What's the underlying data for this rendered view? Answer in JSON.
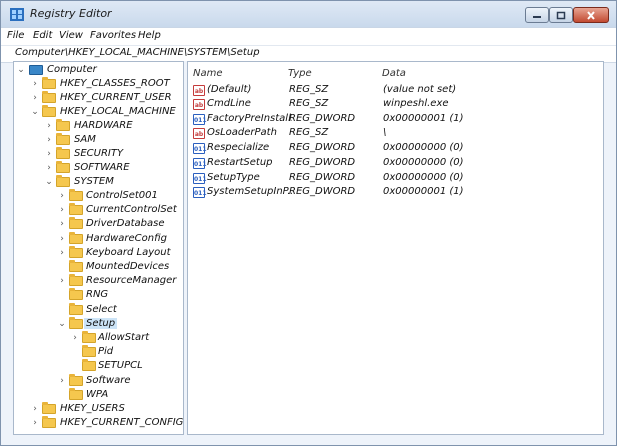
{
  "window": {
    "title": "Registry Editor",
    "accent": "#cce4f7"
  },
  "menu": {
    "file": "File",
    "edit": "Edit",
    "view": "View",
    "favorites": "Favorites",
    "help": "Help"
  },
  "address": "Computer\\HKEY_LOCAL_MACHINE\\SYSTEM\\Setup",
  "tree": [
    {
      "label": "Computer",
      "icon": "computer-icon",
      "expanded": true
    },
    {
      "label": "HKEY_CLASSES_ROOT",
      "icon": "folder-icon",
      "expanded": false
    },
    {
      "label": "HKEY_CURRENT_USER",
      "icon": "folder-icon",
      "expanded": false
    },
    {
      "label": "HKEY_LOCAL_MACHINE",
      "icon": "folder-icon",
      "expanded": true
    },
    {
      "label": "HARDWARE",
      "icon": "folder-icon",
      "expanded": false
    },
    {
      "label": "SAM",
      "icon": "folder-icon",
      "expanded": false
    },
    {
      "label": "SECURITY",
      "icon": "folder-icon",
      "expanded": false
    },
    {
      "label": "SOFTWARE",
      "icon": "folder-icon",
      "expanded": false
    },
    {
      "label": "SYSTEM",
      "icon": "folder-icon",
      "expanded": true
    },
    {
      "label": "ControlSet001",
      "icon": "folder-icon",
      "expanded": false
    },
    {
      "label": "CurrentControlSet",
      "icon": "folder-icon",
      "expanded": false
    },
    {
      "label": "DriverDatabase",
      "icon": "folder-icon",
      "expanded": false
    },
    {
      "label": "HardwareConfig",
      "icon": "folder-icon",
      "expanded": false
    },
    {
      "label": "Keyboard Layout",
      "icon": "folder-icon",
      "expanded": false
    },
    {
      "label": "MountedDevices",
      "icon": "folder-icon",
      "expanded": false
    },
    {
      "label": "ResourceManager",
      "icon": "folder-icon",
      "expanded": false
    },
    {
      "label": "RNG",
      "icon": "folder-icon",
      "expanded": false
    },
    {
      "label": "Select",
      "icon": "folder-icon",
      "expanded": false
    },
    {
      "label": "Setup",
      "icon": "folder-icon",
      "expanded": true,
      "selected": true
    },
    {
      "label": "AllowStart",
      "icon": "folder-icon",
      "expanded": false
    },
    {
      "label": "Pid",
      "icon": "folder-icon",
      "expanded": false
    },
    {
      "label": "SETUPCL",
      "icon": "folder-icon",
      "expanded": false
    },
    {
      "label": "Software",
      "icon": "folder-icon",
      "expanded": false
    },
    {
      "label": "WPA",
      "icon": "folder-icon",
      "expanded": false
    },
    {
      "label": "HKEY_USERS",
      "icon": "folder-icon",
      "expanded": false
    },
    {
      "label": "HKEY_CURRENT_CONFIG",
      "icon": "folder-icon",
      "expanded": false
    }
  ],
  "columns": {
    "name": "Name",
    "type": "Type",
    "data": "Data"
  },
  "values": [
    {
      "name": "(Default)",
      "type": "REG_SZ",
      "data": "(value not set)",
      "icon": "string-value-icon",
      "icon_text": "ab"
    },
    {
      "name": "CmdLine",
      "type": "REG_SZ",
      "data": "winpeshl.exe",
      "icon": "string-value-icon",
      "icon_text": "ab"
    },
    {
      "name": "FactoryPreInstall...",
      "type": "REG_DWORD",
      "data": "0x00000001 (1)",
      "icon": "dword-value-icon",
      "icon_text": "011"
    },
    {
      "name": "OsLoaderPath",
      "type": "REG_SZ",
      "data": "\\",
      "icon": "string-value-icon",
      "icon_text": "ab"
    },
    {
      "name": "Respecialize",
      "type": "REG_DWORD",
      "data": "0x00000000 (0)",
      "icon": "dword-value-icon",
      "icon_text": "011"
    },
    {
      "name": "RestartSetup",
      "type": "REG_DWORD",
      "data": "0x00000000 (0)",
      "icon": "dword-value-icon",
      "icon_text": "011"
    },
    {
      "name": "SetupType",
      "type": "REG_DWORD",
      "data": "0x00000000 (0)",
      "icon": "dword-value-icon",
      "icon_text": "011"
    },
    {
      "name": "SystemSetupInP...",
      "type": "REG_DWORD",
      "data": "0x00000001 (1)",
      "icon": "dword-value-icon",
      "icon_text": "011"
    }
  ]
}
